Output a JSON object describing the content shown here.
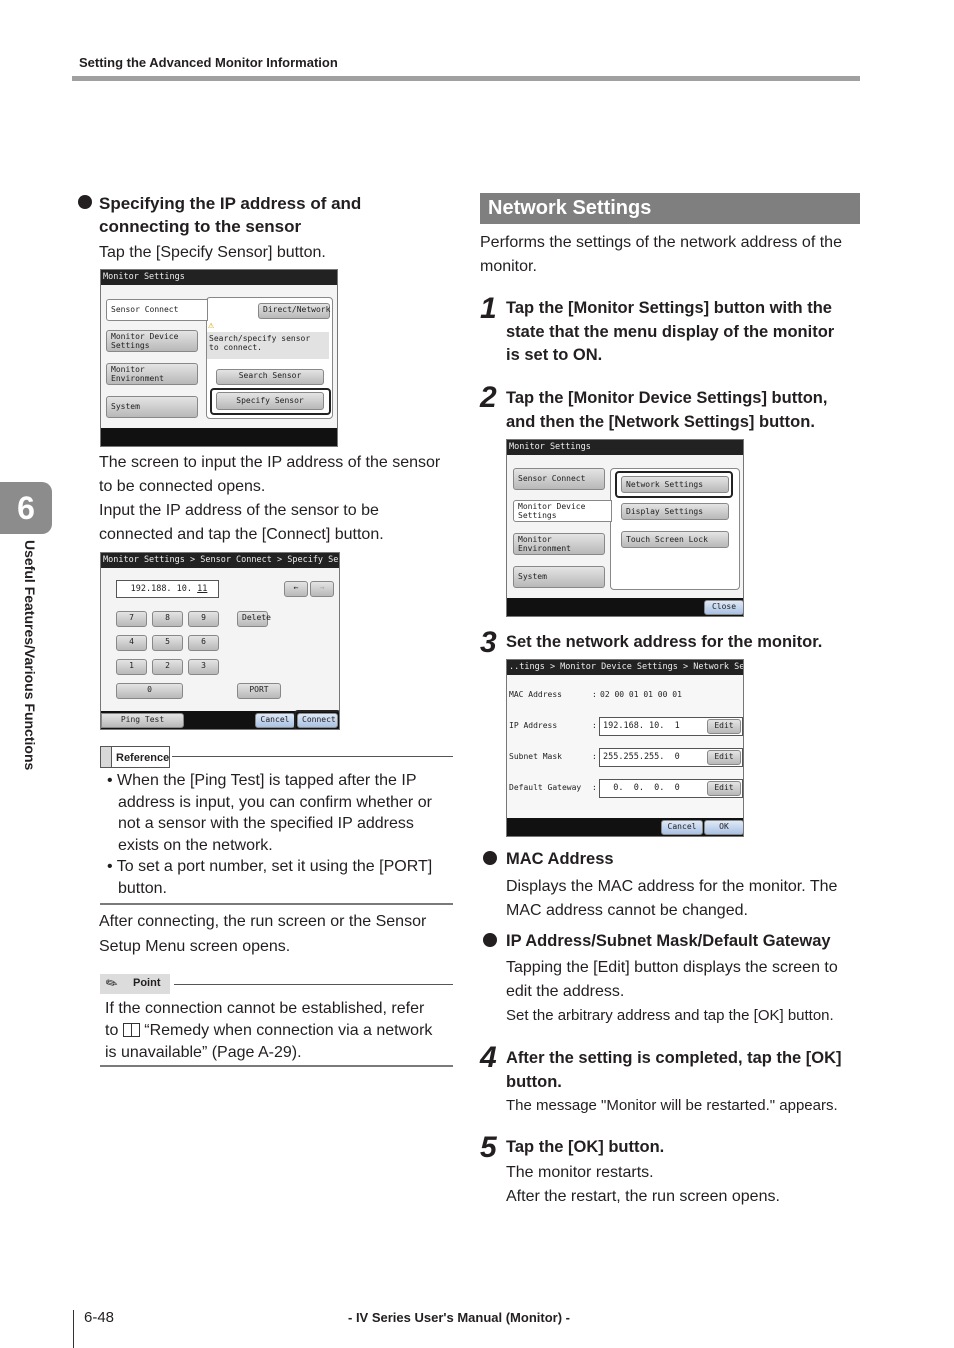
{
  "header": {
    "title": "Setting the Advanced Monitor Information"
  },
  "chapter": {
    "number": "6",
    "title": "Useful Features/Various Functions"
  },
  "left": {
    "section_title_line1": "Specifying the IP address of and",
    "section_title_line2": "connecting to the sensor",
    "instruction1": "Tap the [Specify Sensor] button.",
    "screen1": {
      "title": "Monitor Settings",
      "tabs": [
        "Sensor Connect",
        "Monitor Device\nSettings",
        "Monitor\nEnvironment",
        "System"
      ],
      "direct_network": "Direct/Network",
      "warning": "Search/specify sensor\nto connect.",
      "search_sensor": "Search Sensor",
      "specify_sensor": "Specify Sensor"
    },
    "para1": [
      "The screen to input the IP address of the sensor",
      "to be connected opens.",
      "Input the IP address of the sensor to be",
      "connected and tap the [Connect] button."
    ],
    "screen2": {
      "title": "Monitor Settings > Sensor Connect > Specify Sensor",
      "ip_value": "192.188. 10. ",
      "ip_last": "11",
      "back_arrow": "←",
      "fwd_arrow": "→",
      "keys": [
        "7",
        "8",
        "9",
        "4",
        "5",
        "6",
        "1",
        "2",
        "3",
        "0"
      ],
      "delete": "Delete",
      "port": "PORT",
      "ping_test": "Ping Test",
      "cancel": "Cancel",
      "connect": "Connect"
    },
    "reference": {
      "label": "Reference",
      "items": [
        [
          "When the [Ping Test] is tapped after the IP",
          "address is input, you can confirm whether or",
          "not a sensor with the specified IP address",
          "exists on the network."
        ],
        [
          "To set a port number, set it using the [PORT]",
          "button."
        ]
      ]
    },
    "after_connect": [
      "After connecting, the run screen or the Sensor",
      "Setup Menu screen opens."
    ],
    "point": {
      "label": "Point",
      "lines": [
        "If the connection cannot be established, refer",
        "“Remedy when connection via a network",
        "is unavailable” (Page A-29)."
      ],
      "to_prefix": "to"
    }
  },
  "right": {
    "section_title": "Network Settings",
    "intro": [
      "Performs the settings of the network address of the",
      "monitor."
    ],
    "steps": [
      {
        "num": "1",
        "lines": [
          "Tap the [Monitor Settings] button with the",
          "state that the menu display of the monitor",
          "is set to ON."
        ]
      },
      {
        "num": "2",
        "lines": [
          "Tap the [Monitor Device Settings] button,",
          "and then the [Network Settings] button."
        ]
      },
      {
        "num": "3",
        "lines": [
          "Set the network address for the monitor."
        ]
      },
      {
        "num": "4",
        "lines": [
          "After the setting is completed, tap the [OK]",
          "button."
        ],
        "desc": [
          "The message \"Monitor will be restarted.\" appears."
        ]
      },
      {
        "num": "5",
        "lines": [
          "Tap the [OK] button."
        ],
        "desc": [
          "The monitor restarts.",
          "After the restart, the run screen opens."
        ]
      }
    ],
    "screen3": {
      "title": "Monitor Settings",
      "tabs": [
        "Sensor Connect",
        "Monitor Device\nSettings",
        "Monitor\nEnvironment",
        "System"
      ],
      "options": [
        "Network Settings",
        "Display Settings",
        "Touch Screen Lock"
      ],
      "close": "Close"
    },
    "screen4": {
      "title": "..tings > Monitor Device Settings > Network Settings",
      "rows": [
        {
          "label": "MAC Address",
          "value": "02 00 01 01 00 01"
        },
        {
          "label": "IP Address",
          "value": "192.168. 10.  1",
          "edit": "Edit"
        },
        {
          "label": "Subnet Mask",
          "value": "255.255.255.  0",
          "edit": "Edit"
        },
        {
          "label": "Default Gateway",
          "value": "  0.  0.  0.  0",
          "edit": "Edit"
        }
      ],
      "colon": ":",
      "cancel": "Cancel",
      "ok": "OK"
    },
    "mac": {
      "title": "MAC Address",
      "lines": [
        "Displays the MAC address for the monitor. The",
        "MAC address cannot be changed."
      ]
    },
    "ipsub": {
      "title": "IP Address/Subnet Mask/Default Gateway",
      "lines": [
        "Tapping the [Edit] button displays the screen to",
        "edit the address.",
        "Set the arbitrary address and tap the [OK] button."
      ]
    }
  },
  "footer": {
    "page": "6-48",
    "manual": "- IV Series User's Manual (Monitor) -"
  }
}
